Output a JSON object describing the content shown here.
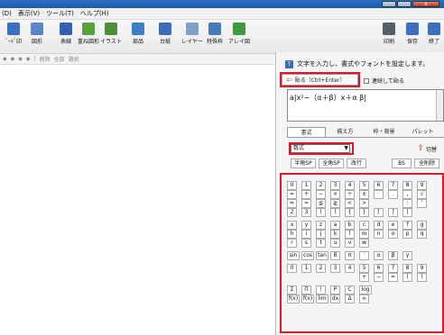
{
  "titlebar": {
    "close": "x"
  },
  "menu": [
    "(D)",
    "表示(V)",
    "ツール(T)",
    "ヘルプ(H)"
  ],
  "toolbar": {
    "left": [
      {
        "label": "ﾞｰﾄﾞ印",
        "icon": "grid-icon",
        "color": "#3b6fbf"
      },
      {
        "label": "図形",
        "icon": "shapes-icon",
        "color": "#5a86c7"
      },
      {
        "label": "表線",
        "icon": "table-icon",
        "color": "#2f63b0"
      },
      {
        "label": "重ね図形",
        "icon": "palette-icon",
        "color": "#5aa03a"
      },
      {
        "label": "イラスト",
        "icon": "image-icon",
        "color": "#4c8f3a"
      },
      {
        "label": "部品",
        "icon": "parts-icon",
        "color": "#3b7fc4"
      },
      {
        "label": "台紙",
        "icon": "board-icon",
        "color": "#3a6db8"
      },
      {
        "label": "レイヤー",
        "icon": "layers-icon",
        "color": "#7f9fc9"
      },
      {
        "label": "特殊枠",
        "icon": "frame-icon",
        "color": "#4a78b8"
      },
      {
        "label": "アレイ図",
        "icon": "array-icon",
        "color": "#3f9a3a"
      }
    ],
    "right": [
      {
        "label": "印刷",
        "icon": "print-icon",
        "color": "#555e6a"
      },
      {
        "label": "保存",
        "icon": "save-icon",
        "color": "#3b6fbf"
      },
      {
        "label": "終了",
        "icon": "exit-icon",
        "color": "#3b6fbf"
      }
    ]
  },
  "subbar": [
    "◆",
    "◆",
    "◆",
    "◆",
    "|",
    "削除",
    "全部",
    "選択"
  ],
  "panel": {
    "instruction": "文字を入力し、書式やフォントを設定します。",
    "paste_button": "貼る（Ctrl+Enter）",
    "continuous_label": "連続して貼る",
    "formula_text": "a|x²−（α＋β）x＋α β|",
    "tabs": [
      "書式",
      "揃え方",
      "枠・背景",
      "パレット"
    ],
    "format_select": "数式",
    "switch_label": "切替",
    "actions": [
      "半角SP",
      "全角SP",
      "改行",
      "BS",
      "全削除"
    ],
    "keys": [
      [
        "0",
        "1",
        "2",
        "3",
        "4",
        "5",
        "6",
        "7",
        "8",
        "9"
      ],
      [
        "=",
        "+",
        "−",
        "×",
        "÷",
        "±",
        "·",
        ".",
        ",",
        "√"
      ],
      [
        "≒",
        "≈",
        "≦",
        "≧",
        "<",
        ">",
        "",
        "",
        ":",
        "'"
      ],
      [
        "2乗",
        "3乗",
        "(",
        ")",
        "{",
        "}",
        "[",
        "]",
        "|",
        ""
      ],
      [
        "x",
        "y",
        "z",
        "a",
        "b",
        "c",
        "d",
        "e",
        "f",
        "g"
      ],
      [
        "h",
        "i",
        "j",
        "k",
        "l",
        "m",
        "n",
        "o",
        "p",
        "q"
      ],
      [
        "r",
        "s",
        "t",
        "u",
        "v",
        "w",
        "",
        "",
        "",
        ""
      ],
      [
        "sin",
        "cos",
        "tan",
        "θ",
        "π",
        "′",
        "α",
        "β",
        "γ",
        ""
      ],
      [
        "0",
        "1",
        "2",
        "3",
        "4",
        "5",
        "6",
        "7",
        "8",
        "9"
      ],
      [
        "",
        "",
        "",
        "",
        "",
        "+",
        "−",
        "=",
        "(",
        ")"
      ],
      [
        "Σ",
        "Π",
        "!",
        "P",
        "C",
        "log",
        "",
        "",
        "",
        ""
      ],
      [
        "f(x)",
        "f(x)",
        "lim",
        "dx",
        "Δ",
        "∞",
        "",
        "",
        "",
        ""
      ]
    ]
  }
}
